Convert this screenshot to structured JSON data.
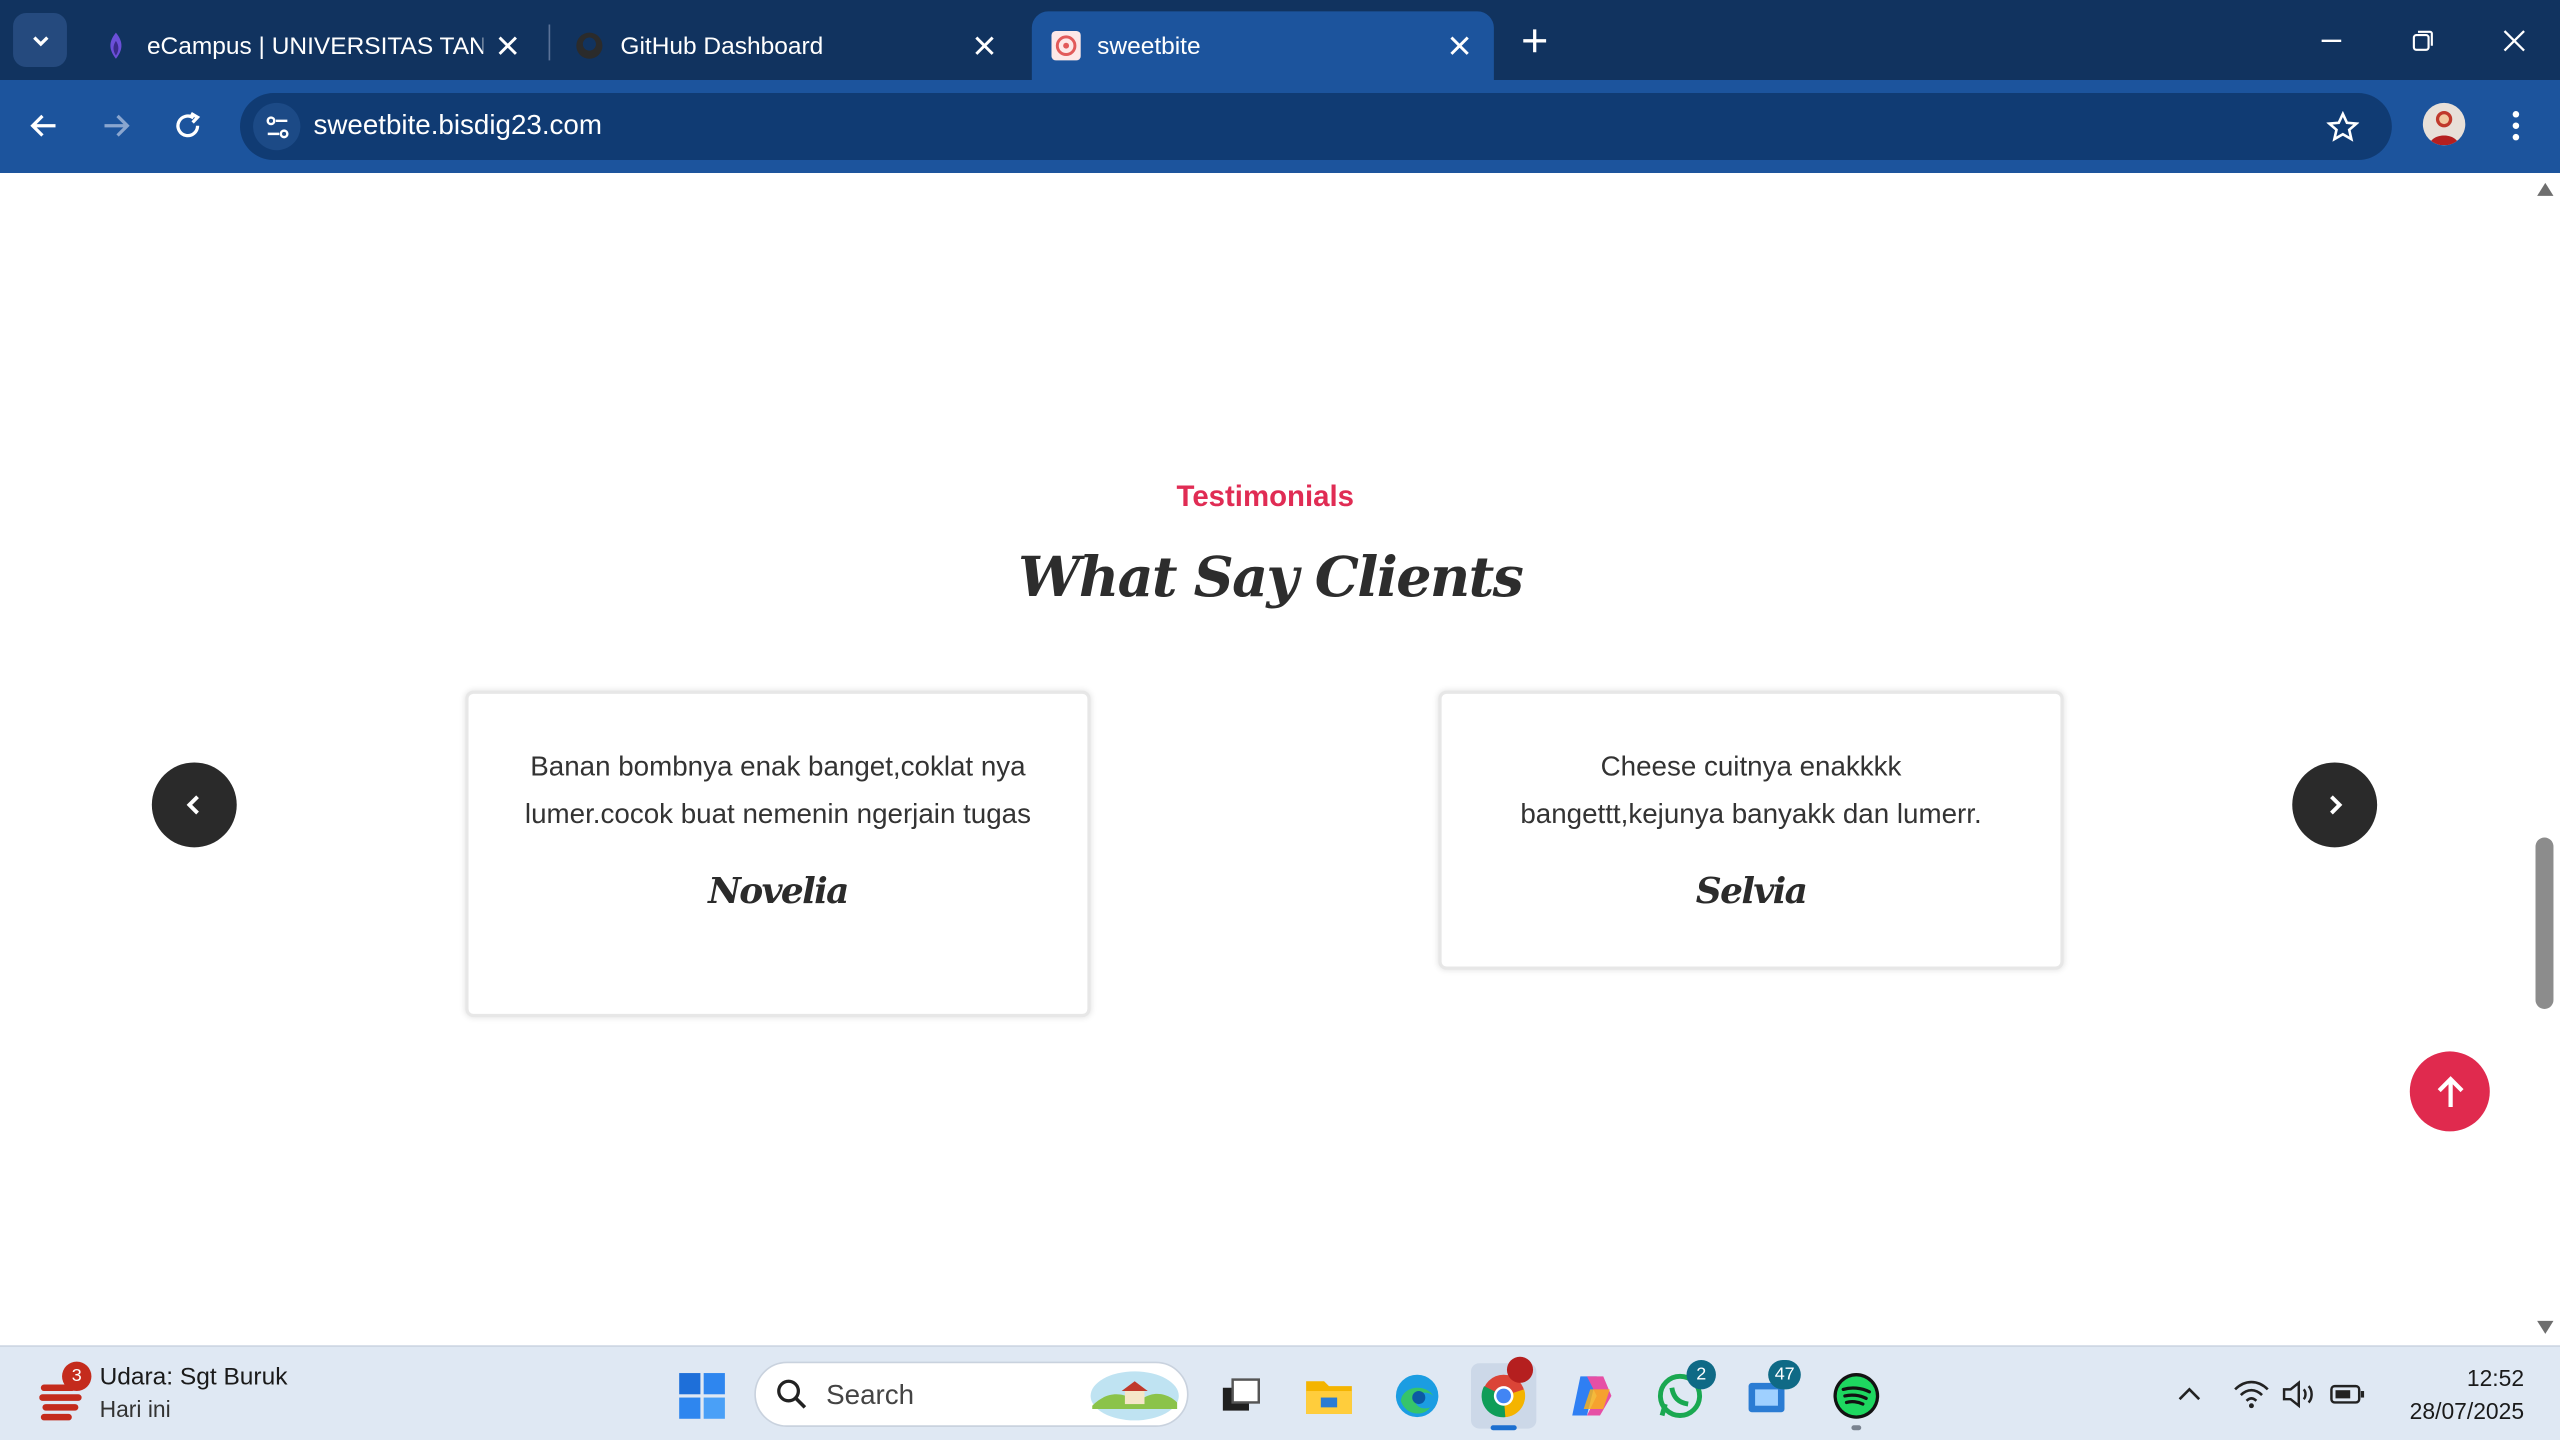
{
  "browser": {
    "tabs": [
      {
        "title": "eCampus | UNIVERSITAS TANGE",
        "favicon": "ecampus-icon"
      },
      {
        "title": "GitHub Dashboard",
        "favicon": "github-icon"
      },
      {
        "title": "sweetbite",
        "favicon": "sweetbite-icon",
        "active": true
      }
    ],
    "url": "sweetbite.bisdig23.com"
  },
  "page": {
    "section_subtitle": "Testimonials",
    "section_title": "What Say Clients",
    "testimonials": [
      {
        "text": "Banan bombnya enak banget,coklat nya lumer.cocok buat nemenin ngerjain tugas",
        "name": "Novelia"
      },
      {
        "text": "Cheese cuitnya enakkkk bangettt,kejunya banyakk dan lumerr.",
        "name": "Selvia"
      }
    ]
  },
  "taskbar": {
    "weather": {
      "badge": "3",
      "line1": "Udara: Sgt Buruk",
      "line2": "Hari ini"
    },
    "search_placeholder": "Search",
    "badges": {
      "whatsapp": "2",
      "todo": "47"
    },
    "time": "12:52",
    "date": "28/07/2025"
  },
  "colors": {
    "accent": "#e02c54",
    "browser_frame": "#11335f",
    "toolbar": "#1c549d",
    "arrow_button": "#2a2a2a",
    "scroll_top_button": "#e02a4e"
  }
}
